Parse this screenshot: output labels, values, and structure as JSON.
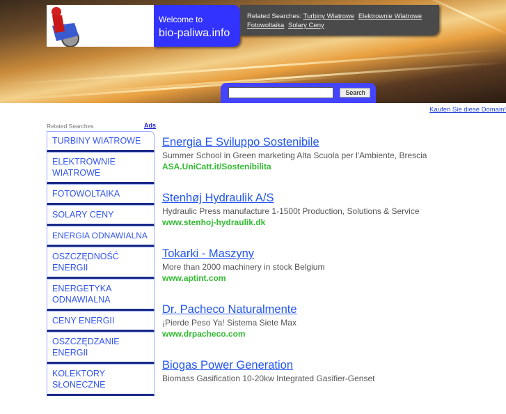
{
  "header": {
    "welcome": "Welcome to",
    "domain": "bio-paliwa.info",
    "related_label": "Related Searches:",
    "related_links": [
      "Turbiny Wiatrowe",
      "Elektrownie Wiatrowe",
      "Fotowoltaika",
      "Solary Ceny"
    ],
    "search_placeholder": "",
    "search_button": "Search"
  },
  "buy_domain": "Kaufen Sie diese Domain!",
  "sidebar": {
    "label": "Related Searches",
    "ads_label": "Ads",
    "items": [
      "TURBINY WIATROWE",
      "ELEKTROWNIE WIATROWE",
      "FOTOWOLTAIKA",
      "SOLARY CENY",
      "ENERGIA ODNAWIALNA",
      "OSZCZĘDNOŚĆ ENERGII",
      "ENERGETYKA ODNAWIALNA",
      "CENY ENERGII",
      "OSZCZĘDZANIE ENERGII",
      "KOLEKTORY SŁONECZNE"
    ]
  },
  "results": [
    {
      "title": "Energia E Sviluppo Sostenibile",
      "desc": "Summer School in Green marketing Alta Scuola per l'Ambiente, Brescia",
      "url": "ASA.UniCatt.it/Sostenibilita"
    },
    {
      "title": "Stenhøj Hydraulik A/S",
      "desc": "Hydraulic Press manufacture 1-1500t Production, Solutions & Service",
      "url": "www.stenhoj-hydraulik.dk"
    },
    {
      "title": "Tokarki - Maszyny",
      "desc": "More than 2000 machinery in stock Belgium",
      "url": "www.aptint.com"
    },
    {
      "title": "Dr. Pacheco Naturalmente",
      "desc": "¡Pierde Peso Ya! Sistema Siete Max",
      "url": "www.drpacheco.com"
    },
    {
      "title": "Biogas Power Generation",
      "desc": "Biomass Gasification 10-20kw Integrated Gasifier-Genset",
      "url": ""
    }
  ]
}
